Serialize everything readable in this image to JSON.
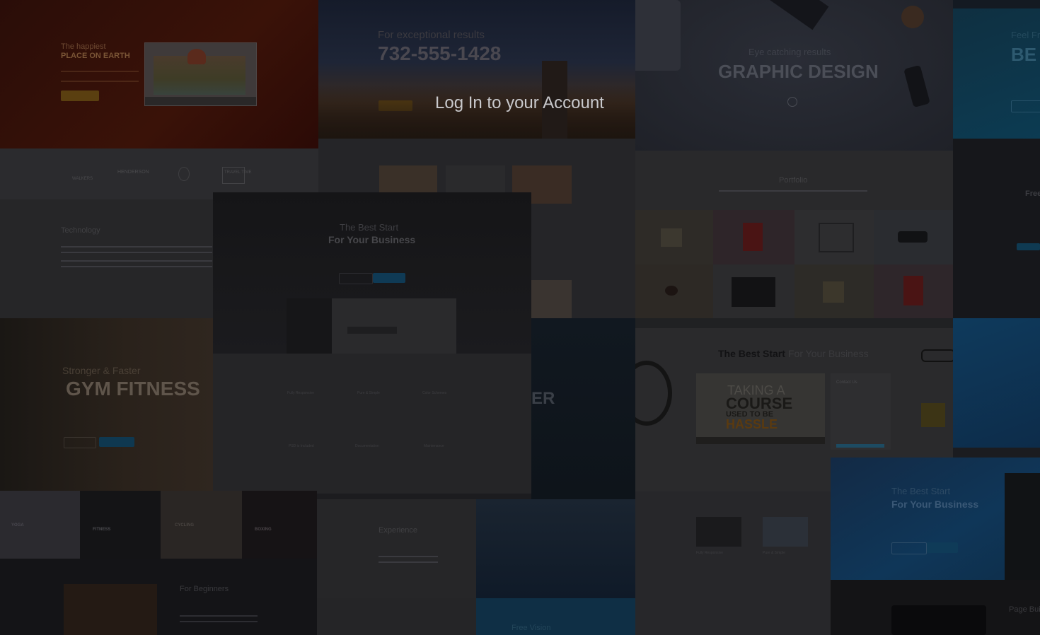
{
  "login": {
    "title": "Log In to your Account"
  },
  "tiles": {
    "happiest": {
      "pre": "The happiest",
      "main": "PLACE ON EARTH"
    },
    "phone": {
      "pre": "For exceptional results",
      "number": "732-555-1428"
    },
    "graphic": {
      "pre": "Eye catching results",
      "main": "GRAPHIC DESIGN"
    },
    "feel": {
      "pre": "Feel Fr",
      "main": "BE"
    },
    "free": {
      "label": "Free"
    },
    "logos": [
      "WALKERS",
      "HENDERSON",
      "TRAVEL TIME"
    ],
    "technology": {
      "title": "Technology"
    },
    "portfolio": {
      "title": "Portfolio"
    },
    "gym": {
      "pre": "Stronger & Faster",
      "main": "GYM FITNESS"
    },
    "classes": [
      "YOGA",
      "FITNESS",
      "CYCLING",
      "BOXING"
    ],
    "beginners": {
      "title": "For Beginners"
    },
    "experience": {
      "title": "Experience"
    },
    "free_vision": {
      "title": "Free Vision"
    },
    "ver": {
      "text": "ER"
    },
    "center": {
      "pre": "The Best Start",
      "main": "For Your Business",
      "features": [
        "Fully Responsive",
        "Pure & Simple",
        "Color Schemes",
        "PSD is Included",
        "Documentation",
        "Maintenance"
      ]
    },
    "best_start_bar": {
      "bold": "The Best Start",
      "rest": "For Your Business"
    },
    "course": {
      "line1": "TAKING A",
      "line2": "COURSE",
      "line3": "USED TO BE",
      "line4": "HASSLE"
    },
    "contact": {
      "title": "Contact Us"
    },
    "blue_start": {
      "pre": "The Best Start",
      "main": "For Your Business"
    },
    "thumbs": [
      "Fully Responsive",
      "Pure & Simple"
    ],
    "page_builder": {
      "title": "Page Bui"
    }
  },
  "colors": {
    "accent_blue": "#1f6f98",
    "gold": "#6b5a1a",
    "overlay": "#000000"
  }
}
